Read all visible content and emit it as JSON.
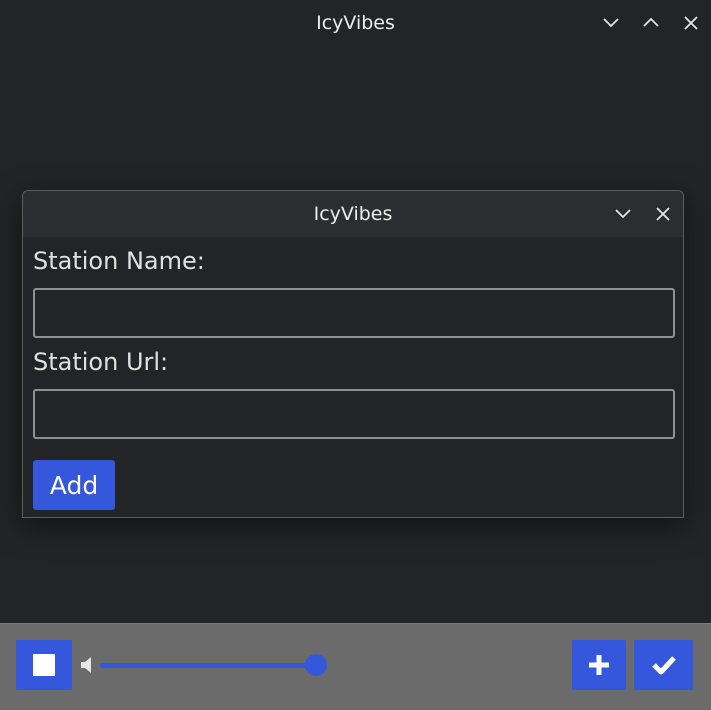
{
  "window": {
    "title": "IcyVibes"
  },
  "dialog": {
    "title": "IcyVibes",
    "station_name_label": "Station Name:",
    "station_name_value": "",
    "station_url_label": "Station Url:",
    "station_url_value": "",
    "add_label": "Add"
  },
  "player": {
    "volume_fraction": 1.0
  },
  "colors": {
    "accent": "#3457db",
    "background": "#232427",
    "bottom_bar": "#6a6b6a"
  }
}
